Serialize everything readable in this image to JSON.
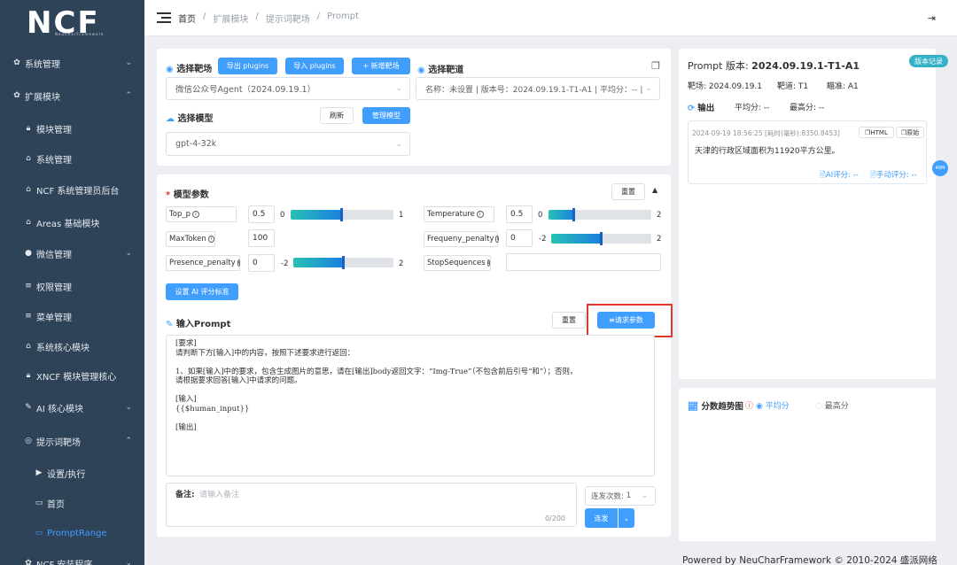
{
  "sidebar": {
    "logo_text": "NCF",
    "logo_sub": "NeuCharFramework",
    "items": [
      {
        "label": "系统管理"
      },
      {
        "label": "扩展模块"
      },
      {
        "label": "模块管理"
      },
      {
        "label": "系统管理"
      },
      {
        "label": "NCF 系统管理员后台"
      },
      {
        "label": "Areas 基础模块"
      },
      {
        "label": "微信管理"
      },
      {
        "label": "权限管理"
      },
      {
        "label": "菜单管理"
      },
      {
        "label": "系统核心模块"
      },
      {
        "label": "XNCF 模块管理核心"
      },
      {
        "label": "AI 核心模块"
      },
      {
        "label": "提示词靶场"
      },
      {
        "label": "设置/执行"
      },
      {
        "label": "首页"
      },
      {
        "label": "PromptRange"
      },
      {
        "label": "NCF 安装程序"
      }
    ]
  },
  "breadcrumb": [
    "首页",
    "/",
    "扩展模块",
    "/",
    "提示词靶场",
    "/",
    "Prompt"
  ],
  "target": {
    "title": "选择靶场",
    "export_btn": "导出 plugins",
    "import_btn": "导入 plugins",
    "new_btn": "+ 新增靶场",
    "selected": "微信公众号Agent（2024.09.19.1）"
  },
  "lane": {
    "title": "选择靶道",
    "selected": "名称：未设置 | 版本号：2024.09.19.1-T1-A1 | 平均分：-- |"
  },
  "model": {
    "title": "选择模型",
    "refresh_btn": "刷新",
    "manage_btn": "管理模型",
    "selected": "gpt-4-32k"
  },
  "params": {
    "title": "模型参数",
    "required_mark": "*",
    "reset_btn": "重置",
    "top_p": {
      "name": "Top_p",
      "value": "0.5",
      "min": "0",
      "max": "1",
      "level": 0.5
    },
    "max_token": {
      "name": "MaxToken",
      "value": "100"
    },
    "presence": {
      "name": "Presence_penalty",
      "value": "0",
      "min": "-2",
      "max": "2",
      "level": 0.5
    },
    "temperature": {
      "name": "Temperature",
      "value": "0.5",
      "min": "0",
      "max": "2",
      "level": 0.25
    },
    "frequency": {
      "name": "Frequeny_penalty",
      "value": "0",
      "min": "-2",
      "max": "2",
      "level": 0.5
    },
    "stop": {
      "name": "StopSequences",
      "value": ""
    },
    "ai_score_btn": "设置 AI 评分标准"
  },
  "prompt": {
    "title": "输入Prompt",
    "reset_btn": "重置",
    "request_btn": "请求参数",
    "content": "[要求]\n请判断下方[输入]中的内容，按照下述要求进行返回：\n\n1、如果[输入]中的要求，包含生成图片的意思，请在[输出]body返回文字：“Img-True”（不包含前后引号“和”）；否则，\n请根据要求回答[输入]中请求的问题。\n\n[输入]\n{{$human_input}}\n\n[输出]"
  },
  "remark": {
    "label": "备注:",
    "placeholder": "请输入备注",
    "counter": "0/200"
  },
  "send": {
    "count_label": "连发次数:",
    "count_value": "1",
    "send_btn": "连发"
  },
  "version_panel": {
    "title_prefix": "Prompt 版本:",
    "version": "2024.09.19.1-T1-A1",
    "tag": "版本记录",
    "range_label": "靶场: 2024.09.19.1",
    "lane_label": "靶道: T1",
    "aim_label": "瞄准: A1",
    "output_label": "输出",
    "avg_label": "平均分: --",
    "max_label": "最高分: --",
    "timestamp": "2024-09-19 18:56:25 [耗时(毫秒):8350.8453]",
    "html_btn": "HTML",
    "copy_btn": "原始",
    "answer": "天津的行政区域面积为11920平方公里。",
    "ai_score": "AI评分: --",
    "manual_score": "手动评分: --",
    "float_badge": "48M"
  },
  "trend": {
    "title": "分数趋势图",
    "option_avg": "平均分",
    "option_max": "最高分"
  },
  "footer": "Powered by NeuCharFramework © 2010-2024 盛派网络",
  "colors": {
    "accent": "#409eff",
    "sidebar": "#2e4358",
    "highlight": "#e0362b"
  }
}
